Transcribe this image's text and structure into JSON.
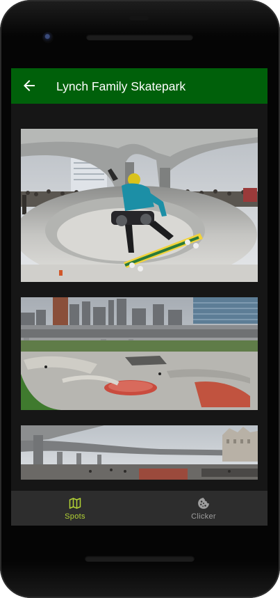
{
  "appbar": {
    "title": "Lynch Family Skatepark",
    "back_icon": "arrow-back-icon",
    "color": "#00600a"
  },
  "spots": [
    {
      "image": "skater-in-bowl-under-bridge-photo"
    },
    {
      "image": "skatepark-aerial-panorama-photo"
    },
    {
      "image": "skatepark-highway-panorama-photo"
    }
  ],
  "bottom_nav": {
    "items": [
      {
        "label": "Spots",
        "icon": "map-icon",
        "active": true,
        "color": "#b3d335"
      },
      {
        "label": "Clicker",
        "icon": "cookie-icon",
        "active": false,
        "color": "#9e9e9e"
      }
    ]
  }
}
